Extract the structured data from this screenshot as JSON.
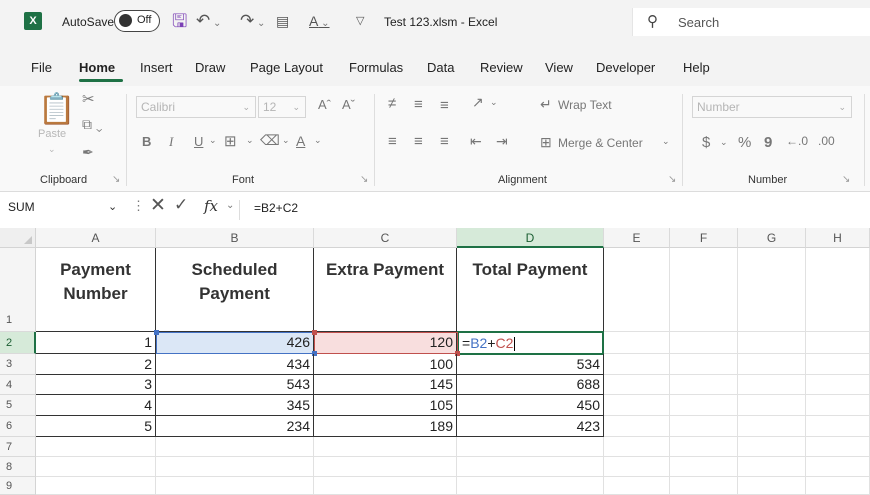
{
  "titlebar": {
    "autosave_label": "AutoSave",
    "autosave_state": "Off",
    "document_title": "Test 123.xlsm  -  Excel",
    "search_placeholder": "Search",
    "icons": [
      "excel-logo-icon",
      "save-icon",
      "undo-icon",
      "redo-icon",
      "clear-format-icon",
      "font-color-icon",
      "customize-toolbar-icon",
      "search-icon"
    ]
  },
  "menu": {
    "tabs": [
      "File",
      "Home",
      "Insert",
      "Draw",
      "Page Layout",
      "Formulas",
      "Data",
      "Review",
      "View",
      "Developer",
      "Help"
    ],
    "active": "Home"
  },
  "ribbon": {
    "clipboard": {
      "label": "Clipboard",
      "paste": "Paste"
    },
    "font": {
      "label": "Font",
      "font_name": "Calibri",
      "font_size": "12",
      "bold": "B",
      "italic": "I",
      "underline": "U",
      "font_color": "A"
    },
    "alignment": {
      "label": "Alignment",
      "wrap_text": "Wrap Text",
      "merge_center": "Merge & Center"
    },
    "number": {
      "label": "Number",
      "format": "Number",
      "currency": "$",
      "percent": "%",
      "comma": "9"
    }
  },
  "formula_bar": {
    "name_box": "SUM",
    "formula": "=B2+C2"
  },
  "sheet": {
    "columns": [
      "A",
      "B",
      "C",
      "D",
      "E",
      "F",
      "G",
      "H"
    ],
    "rows": [
      "1",
      "2",
      "3",
      "4",
      "5",
      "6",
      "7",
      "8",
      "9"
    ],
    "headers": [
      "Payment Number",
      "Scheduled Payment",
      "Extra Payment",
      "Total Payment"
    ],
    "data": [
      {
        "a": "1",
        "b": "426",
        "c": "120",
        "d": "=B2+C2"
      },
      {
        "a": "2",
        "b": "434",
        "c": "100",
        "d": "534"
      },
      {
        "a": "3",
        "b": "543",
        "c": "145",
        "d": "688"
      },
      {
        "a": "4",
        "b": "345",
        "c": "105",
        "d": "450"
      },
      {
        "a": "5",
        "b": "234",
        "c": "189",
        "d": "423"
      }
    ],
    "edit_formula_parts": {
      "eq": "=",
      "ref_b": "B2",
      "plus": "+",
      "ref_c": "C2"
    },
    "colors": {
      "accent": "#1e7145",
      "ref_b": "#4472c4",
      "ref_c": "#c0504d"
    }
  }
}
